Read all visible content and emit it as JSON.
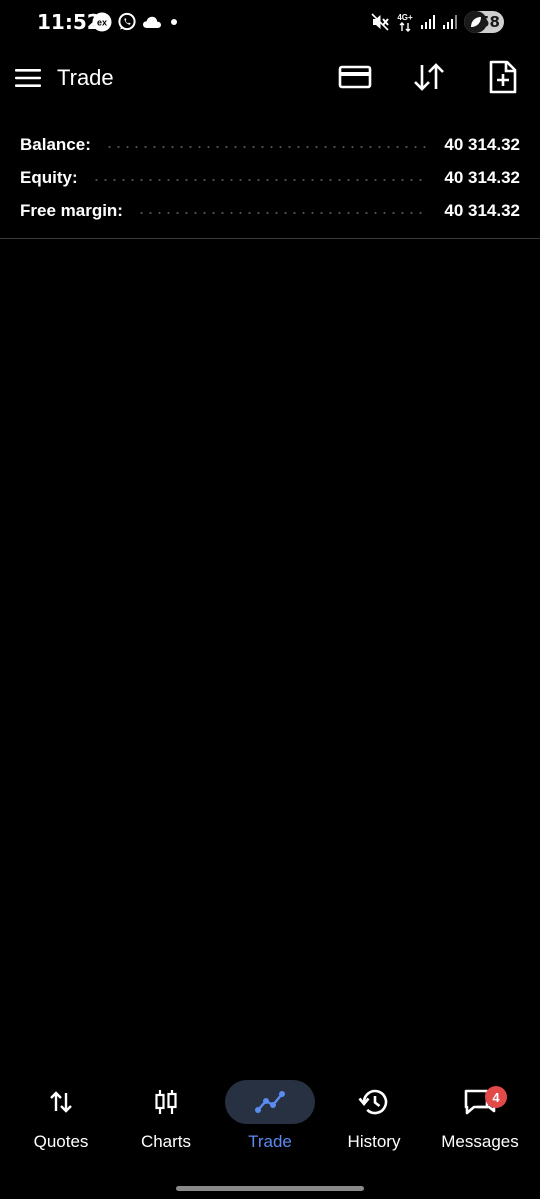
{
  "status_bar": {
    "time": "11:52",
    "battery": "58",
    "network": "4G+",
    "icons": [
      "ex-icon",
      "whatsapp-icon",
      "cloud-icon",
      "dot-icon",
      "mute-icon",
      "signal-icon",
      "signal-icon",
      "battery-icon"
    ]
  },
  "app_bar": {
    "title": "Trade",
    "actions": [
      "wallet-icon",
      "sort-icon",
      "new-order-icon"
    ]
  },
  "summary": [
    {
      "label": "Balance:",
      "value": "40 314.32"
    },
    {
      "label": "Equity:",
      "value": "40 314.32"
    },
    {
      "label": "Free margin:",
      "value": "40 314.32"
    }
  ],
  "nav": {
    "items": [
      {
        "label": "Quotes",
        "icon": "quotes-icon"
      },
      {
        "label": "Charts",
        "icon": "charts-icon"
      },
      {
        "label": "Trade",
        "icon": "trade-icon",
        "active": true
      },
      {
        "label": "History",
        "icon": "history-icon"
      },
      {
        "label": "Messages",
        "icon": "messages-icon",
        "badge": "4"
      }
    ]
  },
  "colors": {
    "background": "#000000",
    "accent": "#5b8bf0",
    "active_pill": "#283142",
    "badge": "#e24a4a"
  }
}
